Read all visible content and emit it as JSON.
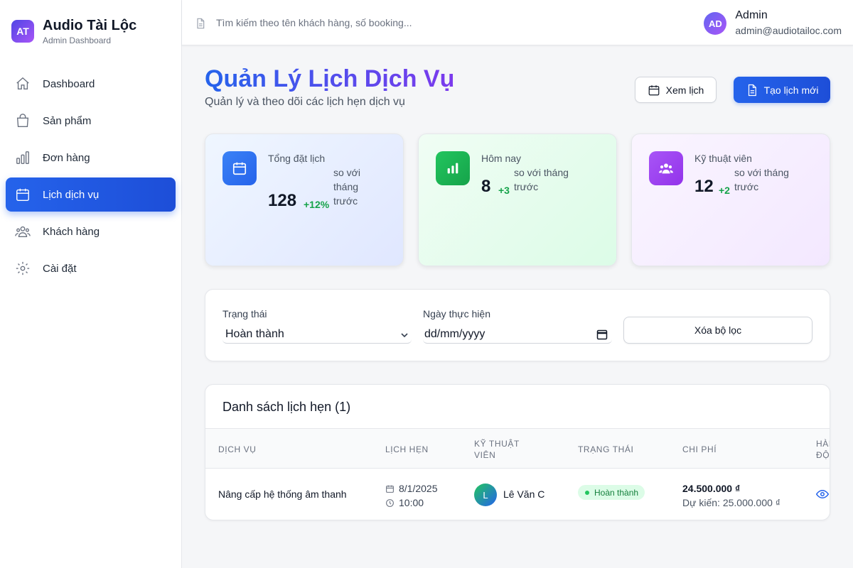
{
  "brand": {
    "logo": "AT",
    "title": "Audio Tài Lộc",
    "subtitle": "Admin Dashboard"
  },
  "nav": [
    {
      "label": "Dashboard",
      "icon": "home-icon"
    },
    {
      "label": "Sản phẩm",
      "icon": "shopping-bag-icon"
    },
    {
      "label": "Đơn hàng",
      "icon": "bar-chart-icon"
    },
    {
      "label": "Lịch dịch vụ",
      "icon": "calendar-icon",
      "active": true
    },
    {
      "label": "Khách hàng",
      "icon": "users-icon"
    },
    {
      "label": "Cài đặt",
      "icon": "gear-icon"
    }
  ],
  "search": {
    "placeholder": "Tìm kiếm theo tên khách hàng, số booking..."
  },
  "user": {
    "avatar": "AD",
    "name": "Admin",
    "email": "admin@audiotailoc.com"
  },
  "page": {
    "title": "Quản Lý Lịch Dịch Vụ",
    "subtitle": "Quản lý và theo dõi các lịch hẹn dịch vụ"
  },
  "actions": {
    "view_calendar": "Xem lịch",
    "create_new": "Tạo lịch mới"
  },
  "stats": [
    {
      "label": "Tổng đặt lịch",
      "value": "128",
      "change": "+12%",
      "note": "so với tháng trước"
    },
    {
      "label": "Hôm nay",
      "value": "8",
      "change": "+3",
      "note": "so với tháng trước"
    },
    {
      "label": "Kỹ thuật viên",
      "value": "12",
      "change": "+2",
      "note": "so với tháng trước"
    }
  ],
  "filters": {
    "status_label": "Trạng thái",
    "status_value": "Hoàn thành",
    "date_label": "Ngày thực hiện",
    "date_placeholder": "dd/mm/yyyy",
    "clear": "Xóa bộ lọc"
  },
  "table": {
    "title": "Danh sách lịch hẹn (1)",
    "columns": [
      "Dịch vụ",
      "Lịch hẹn",
      "Kỹ thuật viên",
      "Trạng thái",
      "Chi phí",
      "Hành động"
    ],
    "rows": [
      {
        "service": "Nâng cấp hệ thống âm thanh",
        "date": "8/1/2025",
        "time": "10:00",
        "tech_initial": "L",
        "tech": "Lê Văn C",
        "status": "Hoàn thành",
        "cost": "24.500.000 ₫",
        "estimate": "Dự kiến: 25.000.000 ₫"
      }
    ]
  },
  "colors": {
    "primary": "#2563eb",
    "accent": "#7c3aed",
    "success": "#16a34a"
  }
}
